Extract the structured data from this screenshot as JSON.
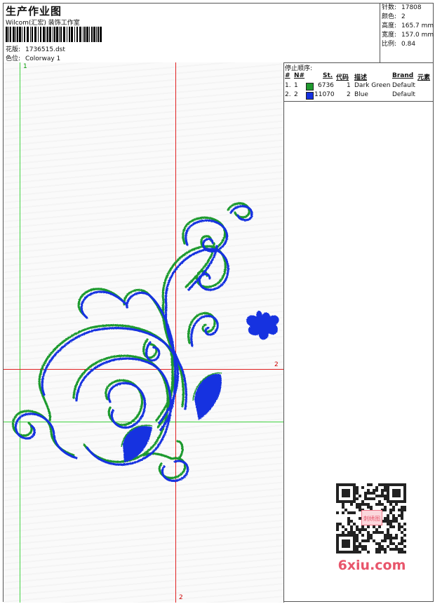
{
  "header": {
    "title": "生产作业图",
    "company": "Wilcom(汇宏) 装饰工作室",
    "design_label": "花版:",
    "design_value": "1736515.dst",
    "colorway_label": "色位:",
    "colorway_value": "Colorway 1"
  },
  "stats": [
    {
      "label": "针数:",
      "value": "17808"
    },
    {
      "label": "颜色:",
      "value": "2"
    },
    {
      "label": "高度:",
      "value": "165.7 mm"
    },
    {
      "label": "宽度:",
      "value": "157.0 mm"
    },
    {
      "label": "比例:",
      "value": "0.84"
    }
  ],
  "legend": {
    "caption": "停止顺序:",
    "columns": [
      "#",
      "N#",
      "St.",
      "代码",
      "描述",
      "Brand",
      "元素"
    ],
    "rows": [
      {
        "num": "1.",
        "n": "1",
        "color": "#1f9a2e",
        "st": "6736",
        "code": "1",
        "desc": "Dark Green",
        "brand": "Default"
      },
      {
        "num": "2.",
        "n": "2",
        "color": "#1530e0",
        "st": "11070",
        "code": "2",
        "desc": "Blue",
        "brand": "Default"
      }
    ]
  },
  "guides": {
    "green_top_label": "1",
    "red_right_label": "2",
    "red_bottom_label": "2"
  },
  "watermark": {
    "text": "6xiu.com",
    "stamp": "刺绣图"
  }
}
